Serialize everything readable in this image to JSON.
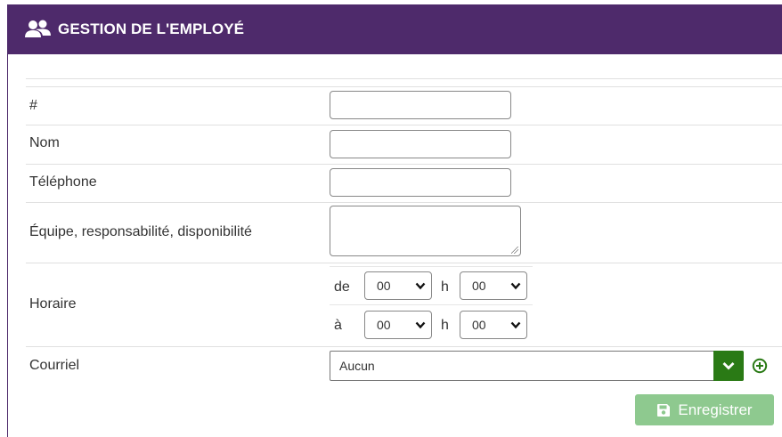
{
  "header": {
    "title": "GESTION DE L'EMPLOYÉ",
    "icon": "users-icon"
  },
  "form": {
    "number_label": "#",
    "name_label": "Nom",
    "phone_label": "Téléphone",
    "team_label": "Équipe, responsabilité, disponibilité",
    "schedule": {
      "label": "Horaire",
      "from_label": "de",
      "to_label": "à",
      "hour_sep": "h",
      "from_hour": "00",
      "from_minute": "00",
      "to_hour": "00",
      "to_minute": "00"
    },
    "email": {
      "label": "Courriel",
      "value": "Aucun"
    }
  },
  "actions": {
    "save_label": "Enregistrer",
    "save_icon": "floppy-disk-icon",
    "add_icon": "plus-circle-icon"
  },
  "colors": {
    "header_bg": "#4e2a6b",
    "accent_green": "#2a7a15",
    "save_bg": "#8ec98f"
  }
}
